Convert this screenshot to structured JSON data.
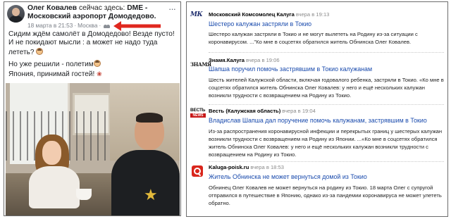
{
  "post": {
    "author": "Олег Ковалев",
    "title_middle": " сейчас здесь: ",
    "place": "DME - Московский аэропорт Домодедово.",
    "date": "18 марта в 21:53",
    "dot": " · ",
    "city": "Москва",
    "dot2": " · ",
    "more": "···",
    "text_line1": "Сидим ждём самолёт в Домодедово! Везде пусто! И не покидают мысли : а может не надо туда лететь?",
    "text_line2a": "Но уже решили - полетим",
    "text_line2b": "Япония, принимай гостей!"
  },
  "feed": {
    "items": [
      {
        "logo": "МК",
        "source": "Московский Комсомолец Калуга",
        "time": "вчера в 19:13",
        "headline": "Шестеро калужан застряли в Токио",
        "snippet": "Шестеро калужан застряли в Токио и не могут вылететь на Родину из-за ситуации с коронавирусом. ...\"Ко мне в соцсетях обратился житель Обнинска Олег Ковалев."
      },
      {
        "logo": "ЗНАМЯ",
        "source": "Знамя.Калуга",
        "time": "вчера в 19:06",
        "headline": "Шапша поручил помочь застрявшим в Токио калужанам",
        "snippet": "Шесть жителей Калужской области, включая годовалого ребенка, застряли в Токио. «Ко мне в соцсетях обратился житель Обнинска Олег Ковалев: у него и ещё нескольких калужан возникли трудности с возвращением на Родину из Токио."
      },
      {
        "logo_top": "ВЕСТЬ",
        "logo_bottom": "NEWS",
        "source": "Весть (Калужская область)",
        "time": "вчера в 19:04",
        "headline": "Владислав Шапша дал поручение помочь калужанам, застрявшим в Токио",
        "snippet": "Из-за распространения коронавирусной инфекции и перекрытых границ у шестерых калужан возникли трудности с возвращением на Родину из Японии. ...«Ко мне в соцсетях обратился житель Обнинска Олег Ковалев: у него и ещё нескольких калужан возникли трудности с возвращением на Родину из Токио."
      },
      {
        "source": "Kaluga-poisk.ru",
        "time": "вчера в 18:53",
        "headline": "Житель Обнинска не может вернуться домой из Токио",
        "snippet": "Обнинец Олег Ковалев не может вернуться на родину из Токио. 18 марта Олег с супругой отправился в путешествие в Японию, однако из-за пандемии коронавируса не может улететь обратно."
      }
    ]
  }
}
